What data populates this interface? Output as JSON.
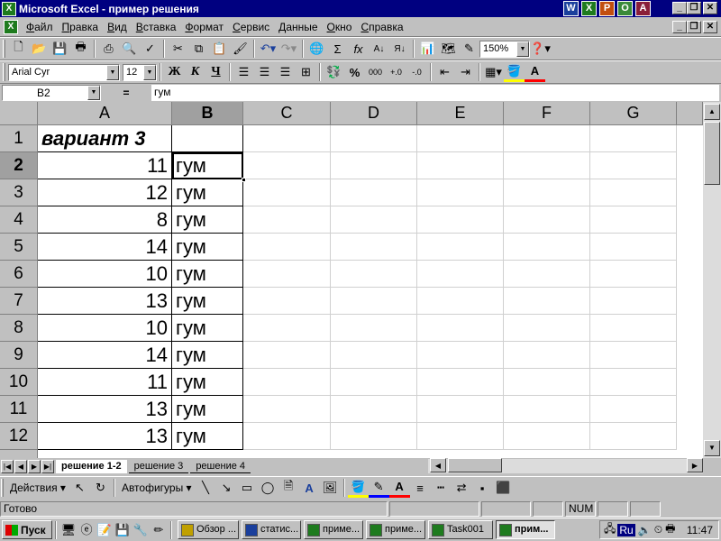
{
  "window": {
    "title": "Microsoft Excel - пример решения",
    "app_icon": "excel-icon"
  },
  "office_icons": [
    {
      "name": "word-icon",
      "glyph": "W",
      "color": "#1a3f9c"
    },
    {
      "name": "excel-icon",
      "glyph": "X",
      "color": "#1e7b1e"
    },
    {
      "name": "powerpoint-icon",
      "glyph": "P",
      "color": "#c24e0f"
    },
    {
      "name": "outlook-icon",
      "glyph": "O",
      "color": "#3a8a3a"
    },
    {
      "name": "access-icon",
      "glyph": "A",
      "color": "#8a1e3a"
    }
  ],
  "menu": [
    "Файл",
    "Правка",
    "Вид",
    "Вставка",
    "Формат",
    "Сервис",
    "Данные",
    "Окно",
    "Справка"
  ],
  "toolbar": {
    "zoom": "150%",
    "font_name": "Arial Cyr",
    "font_size": "12",
    "bold_label": "Ж",
    "italic_label": "К",
    "underline_label": "Ч",
    "percent_label": "%",
    "thousands_label": "000"
  },
  "formula_bar": {
    "name_box": "B2",
    "equals": "=",
    "content": "гум"
  },
  "columns": [
    "A",
    "B",
    "C",
    "D",
    "E",
    "F",
    "G"
  ],
  "rows": [
    {
      "num": "1",
      "a": "вариант 3",
      "b": ""
    },
    {
      "num": "2",
      "a": "11",
      "b": "гум"
    },
    {
      "num": "3",
      "a": "12",
      "b": "гум"
    },
    {
      "num": "4",
      "a": "8",
      "b": "гум"
    },
    {
      "num": "5",
      "a": "14",
      "b": "гум"
    },
    {
      "num": "6",
      "a": "10",
      "b": "гум"
    },
    {
      "num": "7",
      "a": "13",
      "b": "гум"
    },
    {
      "num": "8",
      "a": "10",
      "b": "гум"
    },
    {
      "num": "9",
      "a": "14",
      "b": "гум"
    },
    {
      "num": "10",
      "a": "11",
      "b": "гум"
    },
    {
      "num": "11",
      "a": "13",
      "b": "гум"
    },
    {
      "num": "12",
      "a": "13",
      "b": "гум"
    }
  ],
  "selected_cell": "B2",
  "sheets": [
    {
      "label": "решение 1-2",
      "active": true
    },
    {
      "label": "решение 3",
      "active": false
    },
    {
      "label": "решение 4",
      "active": false
    }
  ],
  "drawing": {
    "actions_label": "Действия",
    "autoshapes_label": "Автофигуры"
  },
  "status": {
    "ready": "Готово",
    "num": "NUM"
  },
  "taskbar": {
    "start_label": "Пуск",
    "tasks": [
      {
        "label": "Обзор ...",
        "icon": "search-icon",
        "color": "#c0a000",
        "pressed": false
      },
      {
        "label": "статис...",
        "icon": "word-icon",
        "color": "#1a3f9c",
        "pressed": false
      },
      {
        "label": "приме...",
        "icon": "excel-icon",
        "color": "#1e7b1e",
        "pressed": false
      },
      {
        "label": "приме...",
        "icon": "excel-icon",
        "color": "#1e7b1e",
        "pressed": false
      },
      {
        "label": "Task001",
        "icon": "excel-icon",
        "color": "#1e7b1e",
        "pressed": false
      },
      {
        "label": "прим...",
        "icon": "excel-icon",
        "color": "#1e7b1e",
        "pressed": true
      }
    ],
    "lang": "Ru",
    "clock": "11:47"
  }
}
